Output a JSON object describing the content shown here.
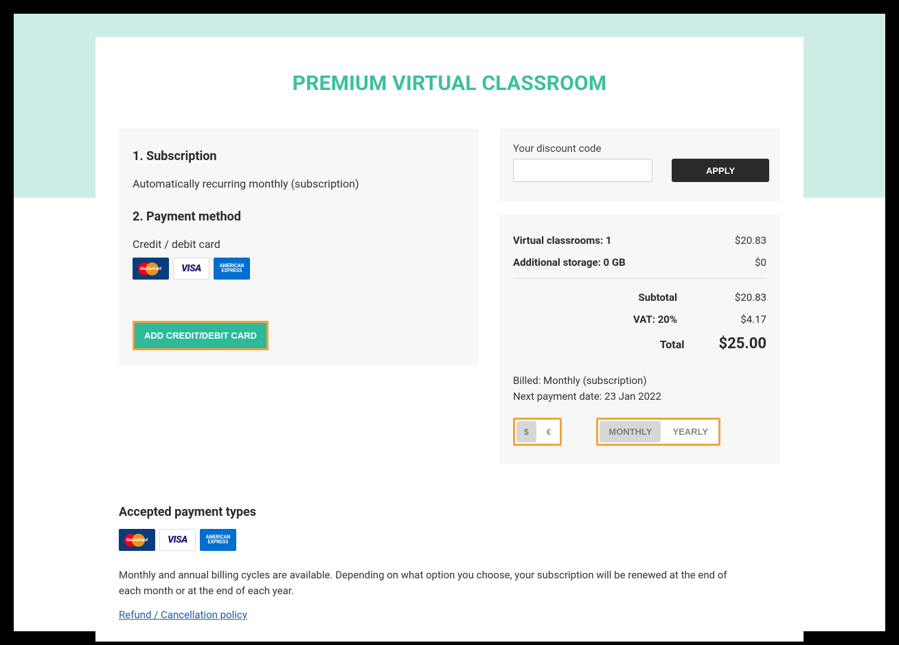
{
  "page_title": "PREMIUM VIRTUAL CLASSROOM",
  "steps": {
    "subscription_title": "1. Subscription",
    "subscription_desc": "Automatically recurring monthly (subscription)",
    "payment_title": "2. Payment method",
    "payment_label": "Credit / debit card",
    "add_card_button": "ADD CREDIT/DEBIT CARD"
  },
  "discount": {
    "label": "Your discount code",
    "value": "",
    "apply_button": "APPLY"
  },
  "summary": {
    "classrooms_label": "Virtual classrooms: 1",
    "classrooms_price": "$20.83",
    "storage_label": "Additional storage: 0 GB",
    "storage_price": "$0",
    "subtotal_label": "Subtotal",
    "subtotal_value": "$20.83",
    "vat_label": "VAT: 20%",
    "vat_value": "$4.17",
    "total_label": "Total",
    "total_value": "$25.00",
    "billed_text": "Billed: Monthly (subscription)",
    "next_payment_text": "Next payment date: 23 Jan 2022"
  },
  "currency_toggle": {
    "usd": "$",
    "eur": "€"
  },
  "cycle_toggle": {
    "monthly": "MONTHLY",
    "yearly": "YEARLY"
  },
  "footer": {
    "accepted_title": "Accepted payment types",
    "note": "Monthly and annual billing cycles are available. Depending on what option you choose, your subscription will be renewed at the end of each month or at the end of each year.",
    "refund_link": "Refund / Cancellation policy"
  },
  "card_brands": {
    "mc": "MasterCard",
    "visa": "VISA",
    "amex": "AMERICAN EXPRESS"
  }
}
